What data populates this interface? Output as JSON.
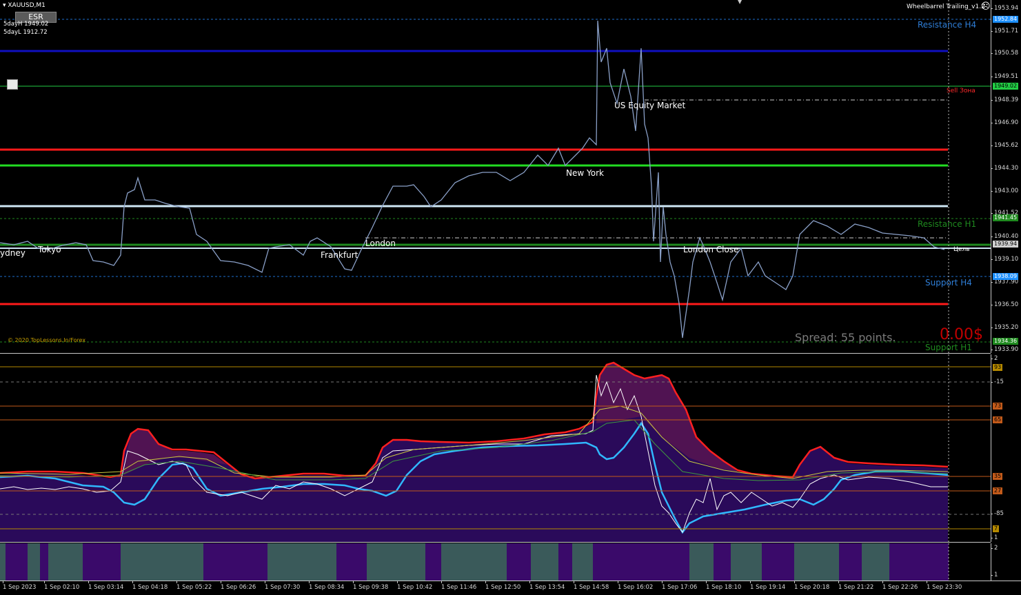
{
  "header": {
    "symbol": "XAUUSD,M1",
    "esr_button": "ESR",
    "five_day_high": "5dayH 1949.02",
    "five_day_low": "5dayL 1912.72",
    "ea_name": "Wheelbarrel Trailing_v1.2",
    "smiley": "☹"
  },
  "chart_labels": {
    "resistance_h4": "Resistance H4",
    "sell_zone": "Sell Зона",
    "us_equity": "US Equity Market",
    "new_york": "New York",
    "resistance_h1": "Resistance H1",
    "sydney": "ydney",
    "tokyo": "Tokyo",
    "frankfurt": "Frankfurt",
    "london": "London",
    "london_close": "London Close",
    "target": "Цель",
    "support_h4": "Support H4",
    "copyright": "© 2020 TopLessons.In/Forex",
    "spread": "Spread: 55 points.",
    "profit": "0.00$",
    "support_h1": "Support H1"
  },
  "price_axis": {
    "ticks": [
      "1953.94",
      "1952.81",
      "1951.71",
      "1950.58",
      "1949.51",
      "1948.39",
      "1946.90",
      "1945.62",
      "1944.30",
      "1943.00",
      "1941.52",
      "1940.40",
      "1939.10",
      "1937.90",
      "1936.50",
      "1935.20",
      "1933.90"
    ],
    "labels": [
      {
        "text": "1952.84",
        "color": "#1e90ff"
      },
      {
        "text": "1949.02",
        "color": "#22cc44"
      },
      {
        "text": "1941.45",
        "color": "#1f8a1f"
      },
      {
        "text": "1939.94",
        "color": "#d0d0d0"
      },
      {
        "text": "1938.09",
        "color": "#1e90ff"
      },
      {
        "text": "1934.36",
        "color": "#1f8a1f"
      }
    ]
  },
  "osc_axis": {
    "ticks": [
      "2",
      "-15",
      "-85",
      "1"
    ],
    "labels": [
      {
        "text": "93",
        "color": "#b58900"
      },
      {
        "text": "73",
        "color": "#c25a1a"
      },
      {
        "text": "65",
        "color": "#c25a1a"
      },
      {
        "text": "35",
        "color": "#c25a1a"
      },
      {
        "text": "27",
        "color": "#c25a1a"
      },
      {
        "text": "7",
        "color": "#b58900"
      }
    ]
  },
  "bar_axis": {
    "ticks": [
      "2",
      "1"
    ]
  },
  "time_axis": {
    "labels": [
      "1 Sep 2023",
      "1 Sep 02:10",
      "1 Sep 03:14",
      "1 Sep 04:18",
      "1 Sep 05:22",
      "1 Sep 06:26",
      "1 Sep 07:30",
      "1 Sep 08:34",
      "1 Sep 09:38",
      "1 Sep 10:42",
      "1 Sep 11:46",
      "1 Sep 12:50",
      "1 Sep 13:54",
      "1 Sep 14:58",
      "1 Sep 16:02",
      "1 Sep 17:06",
      "1 Sep 18:10",
      "1 Sep 19:14",
      "1 Sep 20:18",
      "1 Sep 21:22",
      "1 Sep 22:26",
      "1 Sep 23:30"
    ]
  },
  "colors": {
    "background": "#000000",
    "price_line": "#8aa0c8",
    "resistance_h4": "#1e90ff",
    "resistance_h1": "#1f8a1f",
    "red_levels": "#ff1a1a",
    "green_level": "#22dd22",
    "blue_level": "#1010c0",
    "light_level": "#cfe7f5",
    "osc_fill": "#2a0a5a",
    "osc_red": "#ff2020",
    "osc_cyan": "#30b8ff",
    "bar_teal": "#3a5a5a",
    "bar_purple": "#3a0a6a"
  }
}
